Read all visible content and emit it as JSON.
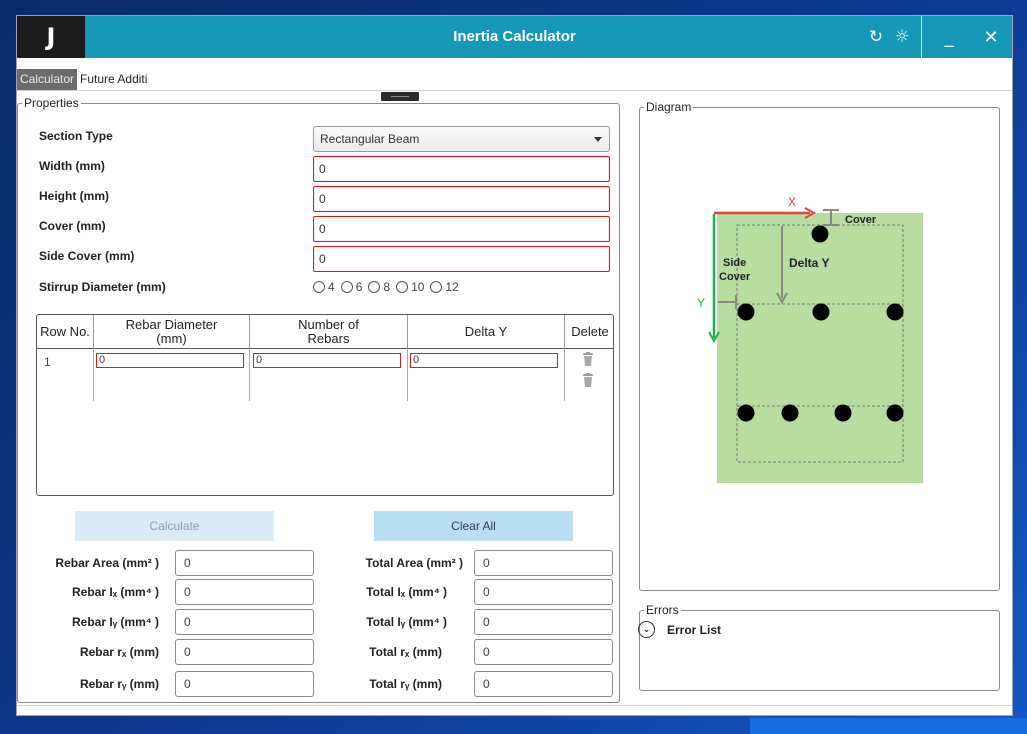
{
  "window": {
    "logo": "J",
    "title": "Inertia Calculator",
    "icons": [
      "refresh-icon",
      "sun-icon"
    ],
    "minimize": "_",
    "close": "✕"
  },
  "tabs": [
    {
      "label": "Calculator",
      "active": true
    },
    {
      "label": "Future Additi",
      "active": false
    }
  ],
  "properties": {
    "legend": "Properties",
    "section_type": {
      "label": "Section Type",
      "value": "Rectangular Beam"
    },
    "width": {
      "label": "Width (mm)",
      "value": "0"
    },
    "height": {
      "label": "Height (mm)",
      "value": "0"
    },
    "cover": {
      "label": "Cover (mm)",
      "value": "0"
    },
    "side_cover": {
      "label": "Side Cover (mm)",
      "value": "0"
    },
    "stirrup": {
      "label": "Stirrup Diameter (mm)",
      "options": [
        "4",
        "6",
        "8",
        "10",
        "12"
      ]
    }
  },
  "rebar_table": {
    "headers": [
      "Row No.",
      "Rebar Diameter\n(mm)",
      "Number of\nRebars",
      "Delta Y",
      "Delete"
    ],
    "rows": [
      {
        "row_no": "1",
        "diameter": "0",
        "count": "0",
        "delta_y": "0"
      }
    ]
  },
  "buttons": {
    "calculate": "Calculate",
    "clear_all": "Clear All"
  },
  "results": {
    "rebar": [
      {
        "label": "Rebar Area (mm² )",
        "value": "0"
      },
      {
        "label": "Rebar Iₓ (mm⁴ )",
        "value": "0"
      },
      {
        "label": "Rebar Iᵧ (mm⁴ )",
        "value": "0"
      },
      {
        "label": "Rebar rₓ (mm)",
        "value": "0"
      },
      {
        "label": "Rebar rᵧ (mm)",
        "value": "0"
      }
    ],
    "total": [
      {
        "label": "Total Area (mm² )",
        "value": "0"
      },
      {
        "label": "Total Iₓ (mm⁴ )",
        "value": "0"
      },
      {
        "label": "Total Iᵧ (mm⁴ )",
        "value": "0"
      },
      {
        "label": "Total rₓ (mm)",
        "value": "0"
      },
      {
        "label": "Total rᵧ (mm)",
        "value": "0"
      }
    ]
  },
  "diagram": {
    "legend": "Diagram",
    "labels": {
      "x": "X",
      "y": "Y",
      "cover": "Cover",
      "side_cover_1": "Side",
      "side_cover_2": "Cover",
      "delta_y": "Delta Y"
    },
    "colors": {
      "section": "#b7dea0",
      "x_axis": "#e84040",
      "y_axis": "#22b04b",
      "rebar": "#000000",
      "dim": "#888888"
    }
  },
  "errors": {
    "legend": "Errors",
    "list_label": "Error List"
  }
}
